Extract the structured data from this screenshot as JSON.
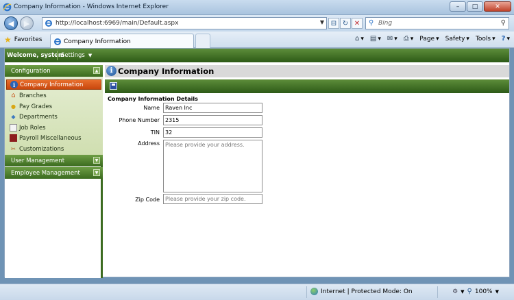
{
  "window": {
    "title": "Company Information - Windows Internet Explorer",
    "minimize": "–",
    "maximize": "□",
    "close": "✕"
  },
  "addressbar": {
    "url": "http://localhost:6969/main/Default.aspx",
    "search_placeholder": "Bing"
  },
  "tabs": {
    "favorites_label": "Favorites",
    "active_tab_label": "Company Information"
  },
  "commandbar": {
    "page_label": "Page",
    "safety_label": "Safety",
    "tools_label": "Tools"
  },
  "app": {
    "welcome": "Welcome, system",
    "settings_label": "Settings"
  },
  "sidebar": {
    "configuration": {
      "title": "Configuration",
      "items": [
        {
          "label": "Company Information",
          "icon": "info-icon",
          "active": true
        },
        {
          "label": "Branches",
          "icon": "house-icon"
        },
        {
          "label": "Pay Grades",
          "icon": "coins-icon"
        },
        {
          "label": "Departments",
          "icon": "users-icon"
        },
        {
          "label": "Job Roles",
          "icon": "card-icon"
        },
        {
          "label": "Payroll Miscellaneous",
          "icon": "book-icon"
        },
        {
          "label": "Customizations",
          "icon": "tools-icon"
        }
      ]
    },
    "user_management": "User Management",
    "employee_management": "Employee Management"
  },
  "main": {
    "title": "Company Information",
    "section_title": "Company Information Details",
    "fields": {
      "name": {
        "label": "Name",
        "value": "Raven Inc"
      },
      "phone": {
        "label": "Phone Number",
        "value": "2315"
      },
      "tin": {
        "label": "TIN",
        "value": "32"
      },
      "address": {
        "label": "Address",
        "placeholder": "Please provide your address."
      },
      "zip": {
        "label": "Zip Code",
        "placeholder": "Please provide your zip code."
      }
    }
  },
  "statusbar": {
    "zone": "Internet | Protected Mode: On",
    "zoom": "100%"
  }
}
